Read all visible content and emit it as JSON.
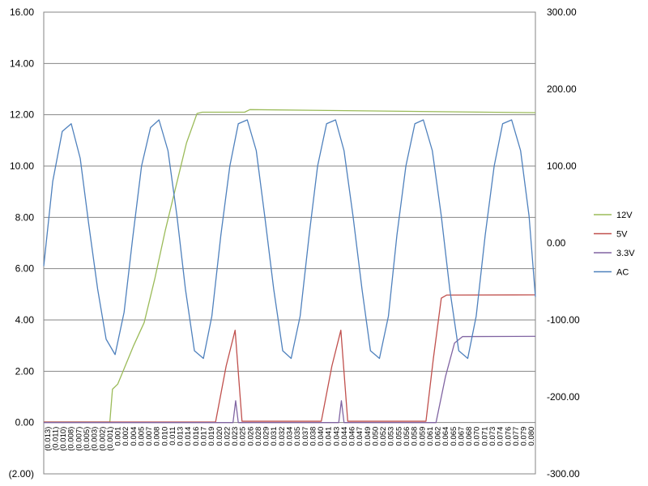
{
  "chart_data": {
    "type": "line",
    "title": "",
    "xlabel": "",
    "ylabel": "",
    "y_left": {
      "range": [
        -2,
        16
      ],
      "ticks": [
        "(2.00)",
        "0.00",
        "2.00",
        "4.00",
        "6.00",
        "8.00",
        "10.00",
        "12.00",
        "14.00",
        "16.00"
      ]
    },
    "y_right": {
      "range": [
        -300,
        300
      ],
      "ticks": [
        "-300.00",
        "-200.00",
        "-100.00",
        "0.00",
        "100.00",
        "200.00",
        "300.00"
      ]
    },
    "x_range": [
      -0.013,
      0.08
    ],
    "x_tick_labels": [
      "(0.013)",
      "(0.011)",
      "(0.010)",
      "(0.008)",
      "(0.007)",
      "(0.005)",
      "(0.003)",
      "(0.002)",
      "(0.001)",
      "0.001",
      "0.002",
      "0.004",
      "0.005",
      "0.007",
      "0.008",
      "0.010",
      "0.011",
      "0.013",
      "0.014",
      "0.016",
      "0.017",
      "0.019",
      "0.020",
      "0.022",
      "0.023",
      "0.025",
      "0.026",
      "0.028",
      "0.029",
      "0.031",
      "0.032",
      "0.034",
      "0.035",
      "0.037",
      "0.038",
      "0.040",
      "0.041",
      "0.043",
      "0.044",
      "0.046",
      "0.047",
      "0.049",
      "0.050",
      "0.052",
      "0.053",
      "0.055",
      "0.056",
      "0.058",
      "0.059",
      "0.061",
      "0.062",
      "0.064",
      "0.065",
      "0.067",
      "0.068",
      "0.070",
      "0.071",
      "0.073",
      "0.074",
      "0.076",
      "0.077",
      "0.079",
      "0.080"
    ],
    "grid": true,
    "legend_position": "right",
    "series": [
      {
        "name": "12V",
        "axis": "left",
        "color": "#9BBB59",
        "x": [
          -0.013,
          -0.0005,
          0.0,
          0.001,
          0.002,
          0.004,
          0.006,
          0.008,
          0.01,
          0.012,
          0.014,
          0.016,
          0.017,
          0.025,
          0.026,
          0.08
        ],
        "y": [
          0.02,
          0.02,
          1.3,
          1.5,
          2.0,
          3.0,
          3.9,
          5.6,
          7.5,
          9.2,
          10.9,
          12.05,
          12.1,
          12.1,
          12.2,
          12.08
        ]
      },
      {
        "name": "5V",
        "axis": "left",
        "color": "#C0504D",
        "x": [
          -0.013,
          0.0195,
          0.0215,
          0.0232,
          0.0245,
          0.0395,
          0.0415,
          0.0432,
          0.0445,
          0.0593,
          0.0607,
          0.0622,
          0.0632,
          0.08
        ],
        "y": [
          0.02,
          0.02,
          2.2,
          3.6,
          0.05,
          0.05,
          2.2,
          3.6,
          0.05,
          0.05,
          2.5,
          4.85,
          4.97,
          4.98
        ]
      },
      {
        "name": "3.3V",
        "axis": "left",
        "color": "#8064A2",
        "x": [
          -0.013,
          0.0228,
          0.0233,
          0.0238,
          0.0428,
          0.0433,
          0.0438,
          0.0612,
          0.063,
          0.0647,
          0.0662,
          0.08
        ],
        "y": [
          0.0,
          0.0,
          0.85,
          0.0,
          0.0,
          0.85,
          0.0,
          0.0,
          1.8,
          3.1,
          3.35,
          3.36
        ]
      },
      {
        "name": "AC",
        "axis": "right",
        "color": "#4F81BD",
        "x": [
          -0.013,
          -0.0113,
          -0.0095,
          -0.0078,
          -0.0061,
          -0.0045,
          -0.0028,
          -0.0012,
          0.0005,
          0.0022,
          0.0038,
          0.0055,
          0.0072,
          0.0088,
          0.0105,
          0.0122,
          0.0138,
          0.0155,
          0.0172,
          0.0188,
          0.0205,
          0.0222,
          0.0238,
          0.0255,
          0.0272,
          0.0288,
          0.0305,
          0.0322,
          0.0338,
          0.0355,
          0.0372,
          0.0388,
          0.0405,
          0.0422,
          0.0438,
          0.0455,
          0.0472,
          0.0488,
          0.0505,
          0.0522,
          0.0538,
          0.0555,
          0.0572,
          0.0588,
          0.0605,
          0.0622,
          0.0638,
          0.0655,
          0.0672,
          0.0688,
          0.0705,
          0.0722,
          0.0738,
          0.0755,
          0.0772,
          0.0788,
          0.08
        ],
        "y": [
          -30,
          80,
          145,
          155,
          110,
          25,
          -60,
          -125,
          -145,
          -90,
          5,
          100,
          150,
          160,
          120,
          35,
          -60,
          -140,
          -150,
          -95,
          10,
          100,
          155,
          160,
          120,
          35,
          -60,
          -140,
          -150,
          -95,
          10,
          100,
          155,
          160,
          120,
          35,
          -60,
          -140,
          -150,
          -95,
          10,
          100,
          155,
          160,
          120,
          35,
          -60,
          -140,
          -150,
          -95,
          10,
          100,
          155,
          160,
          120,
          35,
          -70
        ]
      }
    ]
  }
}
